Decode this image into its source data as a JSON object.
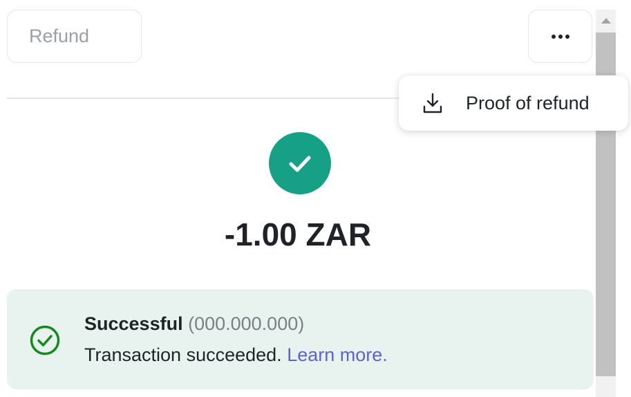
{
  "toolbar": {
    "refund_label": "Refund",
    "more_icon": "more-horizontal-icon"
  },
  "menu": {
    "items": [
      {
        "label": "Proof of refund",
        "icon": "download-icon"
      }
    ]
  },
  "transaction": {
    "status_icon": "check-circle-icon",
    "amount": "-1.00 ZAR"
  },
  "status": {
    "title": "Successful",
    "id": "(000.000.000)",
    "message": "Transaction succeeded.",
    "link_label": "Learn more."
  },
  "colors": {
    "success_green": "#16a085",
    "panel_bg": "#e8f3ef",
    "link_blue": "#5b63d3",
    "status_icon_green": "#118a1e"
  }
}
